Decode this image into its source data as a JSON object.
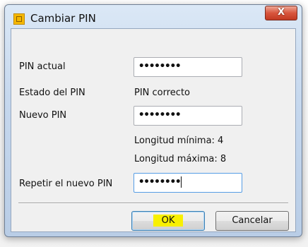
{
  "window": {
    "title": "Cambiar PIN",
    "close_label": "X"
  },
  "form": {
    "current_pin_label": "PIN actual",
    "current_pin_value": "••••••••",
    "pin_status_label": "Estado del PIN",
    "pin_status_value": "PIN correcto",
    "new_pin_label": "Nuevo PIN",
    "new_pin_value": "••••••••",
    "min_length_text": "Longitud mínima: 4",
    "max_length_text": "Longitud máxima: 8",
    "repeat_pin_label": "Repetir el nuevo PIN",
    "repeat_pin_value": "••••••••"
  },
  "buttons": {
    "ok_label": "OK",
    "cancel_label": "Cancelar"
  },
  "colors": {
    "ok_highlight": "#f8f000",
    "close_button": "#c23a22"
  }
}
